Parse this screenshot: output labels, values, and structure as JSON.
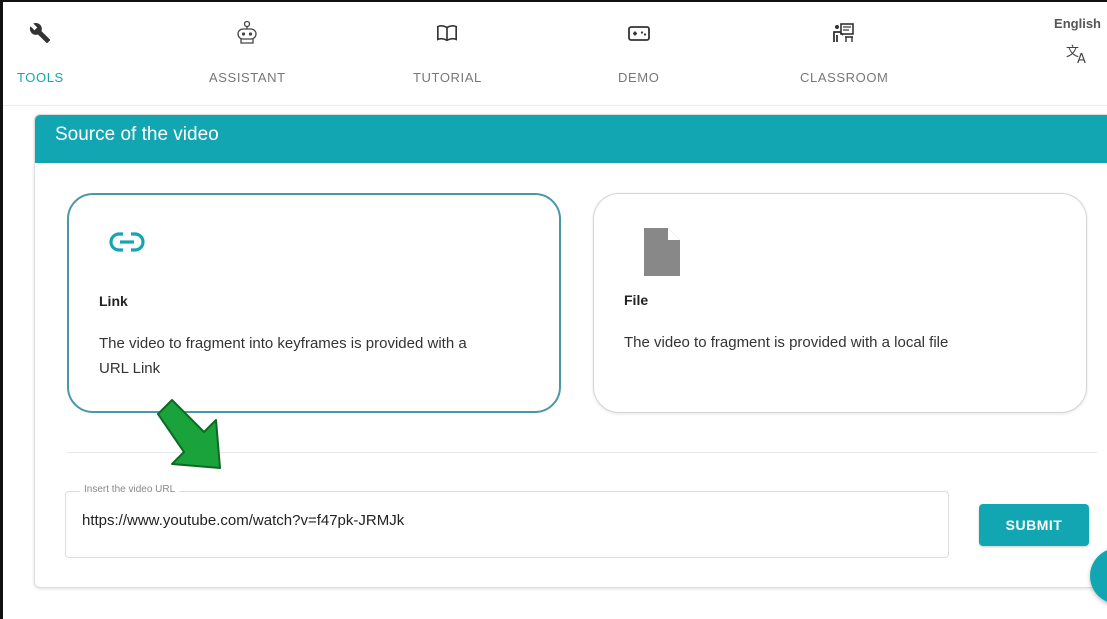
{
  "nav": {
    "items": [
      {
        "label": "TOOLS",
        "icon": "wrench-icon",
        "active": true
      },
      {
        "label": "ASSISTANT",
        "icon": "robot-icon",
        "active": false
      },
      {
        "label": "TUTORIAL",
        "icon": "book-icon",
        "active": false
      },
      {
        "label": "DEMO",
        "icon": "gamepad-icon",
        "active": false
      },
      {
        "label": "CLASSROOM",
        "icon": "classroom-icon",
        "active": false
      }
    ],
    "language": "English",
    "translate_icon": "translate-icon"
  },
  "card": {
    "title": "Source of the video",
    "options": [
      {
        "title": "Link",
        "description": "The video to fragment into keyframes is provided with a URL Link",
        "icon": "link-icon",
        "selected": true
      },
      {
        "title": "File",
        "description": "The video to fragment is provided with a local file",
        "icon": "file-icon",
        "selected": false
      }
    ],
    "url_field": {
      "label": "Insert the video URL",
      "value": "https://www.youtube.com/watch?v=f47pk-JRMJk"
    },
    "submit_label": "SUBMIT"
  },
  "colors": {
    "accent": "#12a6b2",
    "arrow": "#1aa33b"
  }
}
